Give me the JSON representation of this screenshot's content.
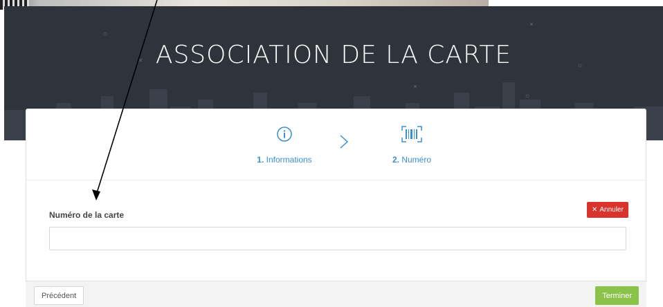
{
  "hero": {
    "title": "ASSOCIATION DE LA CARTE"
  },
  "steps": [
    {
      "number": "1.",
      "label": "Informations",
      "icon": "info-icon"
    },
    {
      "number": "2.",
      "label": "Numéro",
      "icon": "barcode-icon"
    }
  ],
  "form": {
    "card_number_label": "Numéro de la carte",
    "card_number_value": "",
    "cancel_label": "Annuler",
    "cancel_icon": "close-icon"
  },
  "footer": {
    "previous_label": "Précédent",
    "finish_label": "Terminer"
  },
  "colors": {
    "hero_bg": "#2f333c",
    "accent_blue": "#3a8fd0",
    "cancel_red": "#d9342b",
    "finish_green": "#8bc34a"
  }
}
